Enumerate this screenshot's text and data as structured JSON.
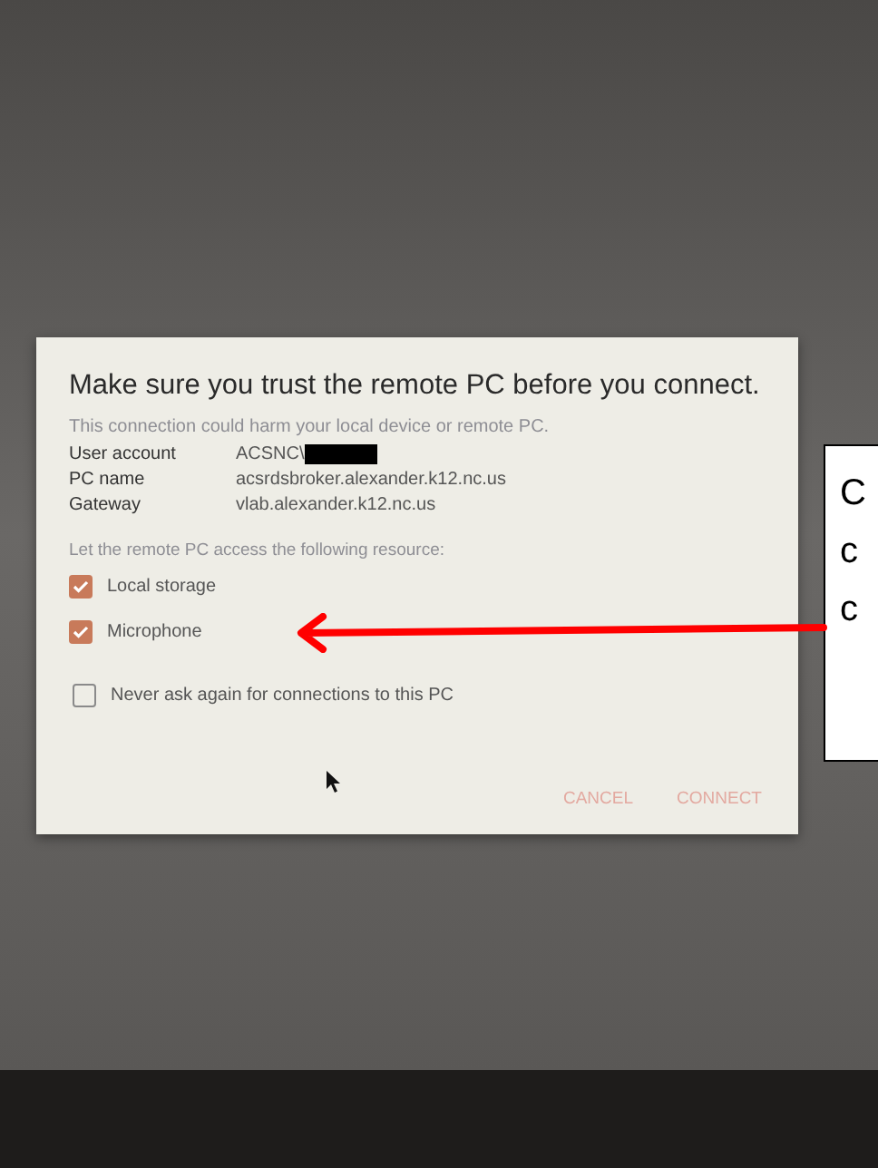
{
  "dialog": {
    "title": "Make sure you trust the remote PC before you connect.",
    "warning": "This connection could harm your local device or remote PC.",
    "details": [
      {
        "label": "User account",
        "value": "ACSNC\\",
        "redacted": true
      },
      {
        "label": "PC name",
        "value": "acsrdsbroker.alexander.k12.nc.us",
        "redacted": false
      },
      {
        "label": "Gateway",
        "value": "vlab.alexander.k12.nc.us",
        "redacted": false
      }
    ],
    "resources_label": "Let the remote PC access the following resource:",
    "resources": [
      {
        "label": "Local storage",
        "checked": true
      },
      {
        "label": "Microphone",
        "checked": true
      }
    ],
    "never_ask": {
      "label": "Never ask again for connections to this PC",
      "checked": false
    },
    "buttons": [
      "CANCEL",
      "CONNECT"
    ]
  },
  "callout": {
    "lines": [
      "C",
      "c",
      "c"
    ]
  }
}
